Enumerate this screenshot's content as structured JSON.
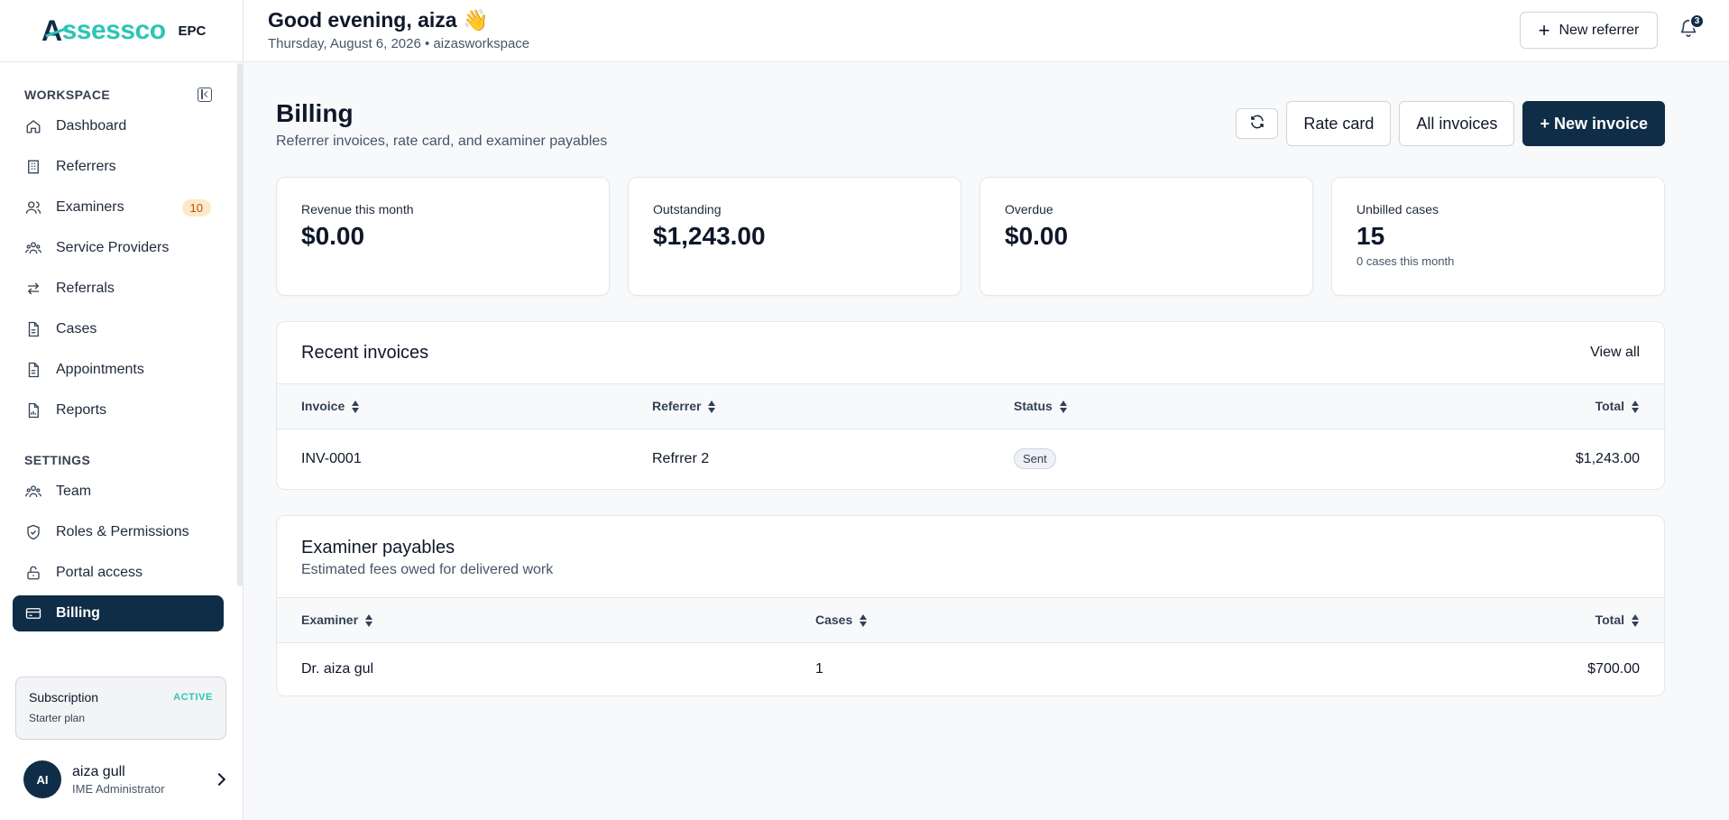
{
  "brand": {
    "logo_a": "A",
    "logo_rest": "ssessco",
    "tag": "EPC"
  },
  "sidebar": {
    "workspace_label": "WORKSPACE",
    "settings_label": "SETTINGS",
    "workspace_items": [
      {
        "label": "Dashboard",
        "icon": "home-icon"
      },
      {
        "label": "Referrers",
        "icon": "building-icon"
      },
      {
        "label": "Examiners",
        "icon": "users-icon",
        "badge": "10"
      },
      {
        "label": "Service Providers",
        "icon": "group-icon"
      },
      {
        "label": "Referrals",
        "icon": "arrows-icon"
      },
      {
        "label": "Cases",
        "icon": "file-icon"
      },
      {
        "label": "Appointments",
        "icon": "file-icon"
      },
      {
        "label": "Reports",
        "icon": "chart-file-icon"
      }
    ],
    "settings_items": [
      {
        "label": "Team",
        "icon": "group-icon"
      },
      {
        "label": "Roles & Permissions",
        "icon": "shield-icon"
      },
      {
        "label": "Portal access",
        "icon": "lock-icon"
      },
      {
        "label": "Billing",
        "icon": "card-icon",
        "active": true
      }
    ],
    "subscription": {
      "title": "Subscription",
      "status": "ACTIVE",
      "plan": "Starter plan"
    },
    "user": {
      "initials": "AI",
      "name": "aiza gull",
      "role": "IME Administrator"
    }
  },
  "topbar": {
    "greeting": "Good evening, aiza 👋",
    "subtitle": "Thursday, August 6, 2026 • aizasworkspace",
    "new_referrer": "New referrer",
    "notifications": "3"
  },
  "page": {
    "title": "Billing",
    "subtitle": "Referrer invoices, rate card, and examiner payables",
    "actions": {
      "rate_card": "Rate card",
      "all_invoices": "All invoices",
      "new_invoice": "+ New invoice"
    }
  },
  "kpis": [
    {
      "label": "Revenue this month",
      "value": "$0.00"
    },
    {
      "label": "Outstanding",
      "value": "$1,243.00"
    },
    {
      "label": "Overdue",
      "value": "$0.00"
    },
    {
      "label": "Unbilled cases",
      "value": "15",
      "sub": "0 cases this month"
    }
  ],
  "recent_invoices": {
    "title": "Recent invoices",
    "view_all": "View all",
    "columns": [
      "Invoice",
      "Referrer",
      "Status",
      "Total"
    ],
    "rows": [
      {
        "invoice": "INV-0001",
        "referrer": "Refrrer 2",
        "status": "Sent",
        "total": "$1,243.00"
      }
    ]
  },
  "examiner_payables": {
    "title": "Examiner payables",
    "subtitle": "Estimated fees owed for delivered work",
    "columns": [
      "Examiner",
      "Cases",
      "Total"
    ],
    "rows": [
      {
        "examiner": "Dr. aiza gul",
        "cases": "1",
        "total": "$700.00"
      }
    ]
  }
}
